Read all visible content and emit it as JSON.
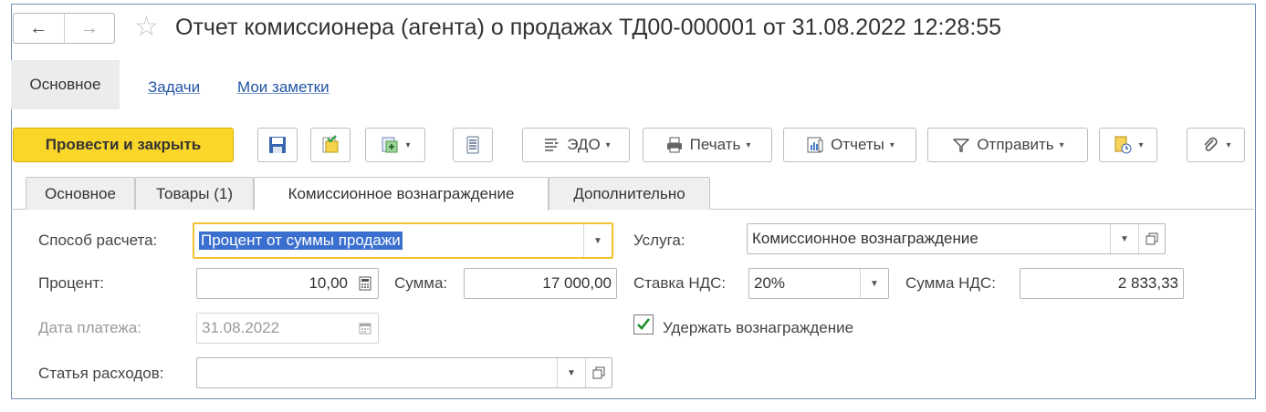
{
  "header": {
    "back": "←",
    "forward": "→",
    "title": "Отчет комиссионера (агента) о продажах ТД00-000001 от 31.08.2022 12:28:55"
  },
  "nav": {
    "items": [
      {
        "label": "Основное",
        "active": true
      },
      {
        "label": "Задачи"
      },
      {
        "label": "Мои заметки"
      }
    ]
  },
  "toolbar": {
    "post_close": "Провести и закрыть",
    "edo": "ЭДО",
    "print": "Печать",
    "reports": "Отчеты",
    "send": "Отправить",
    "icons": [
      "save-icon",
      "post-icon",
      "create-based-icon",
      "list-icon",
      "edo-icon",
      "printer-icon",
      "reports-icon",
      "send-icon",
      "document-clock-icon",
      "paperclip-icon"
    ]
  },
  "tabs": [
    {
      "label": "Основное"
    },
    {
      "label": "Товары (1)"
    },
    {
      "label": "Комиссионное вознаграждение",
      "active": true
    },
    {
      "label": "Дополнительно"
    }
  ],
  "form": {
    "calc_method_label": "Способ расчета:",
    "calc_method_value": "Процент от суммы продажи",
    "percent_label": "Процент:",
    "percent_value": "10,00",
    "sum_label": "Сумма:",
    "sum_value": "17 000,00",
    "payment_date_label": "Дата платежа:",
    "payment_date_value": "31.08.2022",
    "expense_item_label": "Статья расходов:",
    "expense_item_value": "",
    "service_label": "Услуга:",
    "service_value": "Комиссионное вознаграждение",
    "vat_rate_label": "Ставка НДС:",
    "vat_rate_value": "20%",
    "vat_sum_label": "Сумма НДС:",
    "vat_sum_value": "2 833,33",
    "withhold_label": "Удержать вознаграждение",
    "withhold_checked": true
  },
  "colors": {
    "accent_yellow": "#fad628",
    "link": "#2255a4",
    "focus": "#f1c232",
    "selection": "#3a6fd0",
    "check": "#1a8f2a"
  }
}
